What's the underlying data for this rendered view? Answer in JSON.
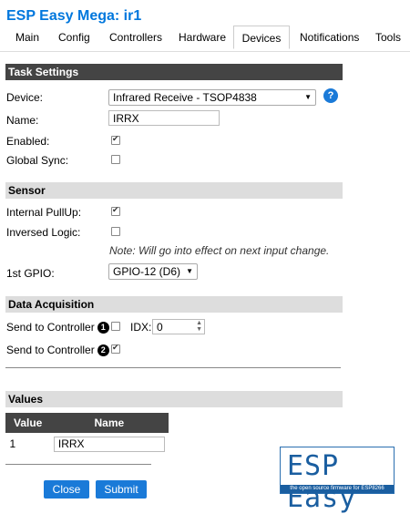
{
  "app": {
    "title": "ESP Easy Mega: ir1"
  },
  "tabs": [
    "Main",
    "Config",
    "Controllers",
    "Hardware",
    "Devices",
    "Notifications",
    "Tools"
  ],
  "active_tab": "Devices",
  "task_settings": {
    "heading": "Task Settings",
    "device_label": "Device:",
    "device_value": "Infrared Receive - TSOP4838",
    "help_glyph": "?",
    "name_label": "Name:",
    "name_value": "IRRX",
    "enabled_label": "Enabled:",
    "enabled": true,
    "global_sync_label": "Global Sync:",
    "global_sync": false
  },
  "sensor": {
    "heading": "Sensor",
    "pullup_label": "Internal PullUp:",
    "pullup": true,
    "inversed_label": "Inversed Logic:",
    "inversed": false,
    "note": "Note: Will go into effect on next input change.",
    "gpio_label": "1st GPIO:",
    "gpio_value": "GPIO-12 (D6)"
  },
  "data_acquisition": {
    "heading": "Data Acquisition",
    "send1_label": "Send to Controller",
    "send1_num": "1",
    "send1": false,
    "idx_label": "IDX:",
    "idx_value": "0",
    "send2_label": "Send to Controller",
    "send2_num": "2",
    "send2": true
  },
  "values": {
    "heading": "Values",
    "col_value": "Value",
    "col_name": "Name",
    "rows": [
      {
        "value": "1",
        "name": "IRRX"
      }
    ]
  },
  "buttons": {
    "close": "Close",
    "submit": "Submit"
  },
  "logo": {
    "big": "ESP Easy",
    "small": "the open source firmware for ESP8266"
  },
  "colors": {
    "accent": "#1a7ad8",
    "header_bg": "#444444",
    "section_light": "#dddddd"
  }
}
